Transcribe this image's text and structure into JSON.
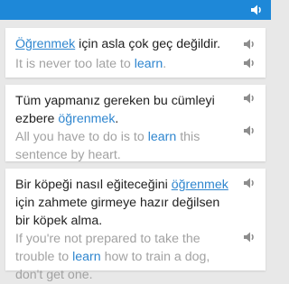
{
  "header": {
    "speaker_icon": "speaker-icon",
    "color": "#1e88d8"
  },
  "colors": {
    "keyword": "#2f86cf",
    "translation": "#a2a2a2",
    "text": "#222222"
  },
  "sentences": [
    {
      "tr_before": "",
      "tr_keyword": "Öğrenmek",
      "tr_after": " için asla çok geç değildir.",
      "en_before": "It is never too late to ",
      "en_keyword": "learn",
      "en_after": "."
    },
    {
      "tr_before": "Tüm yapmanız gereken bu cümleyi ezbere ",
      "tr_keyword": "öğrenmek",
      "tr_after": ".",
      "en_before": "All you have to do is to ",
      "en_keyword": "learn",
      "en_after": " this sentence by heart."
    },
    {
      "tr_before": "Bir köpeği nasıl eğiteceğini ",
      "tr_keyword": "öğrenmek",
      "tr_after": " için zahmete girmeye hazır değilsen bir köpek alma.",
      "en_before": "If you're not prepared to take the trouble to ",
      "en_keyword": "learn",
      "en_after": " how to train a dog, don't get one."
    }
  ]
}
